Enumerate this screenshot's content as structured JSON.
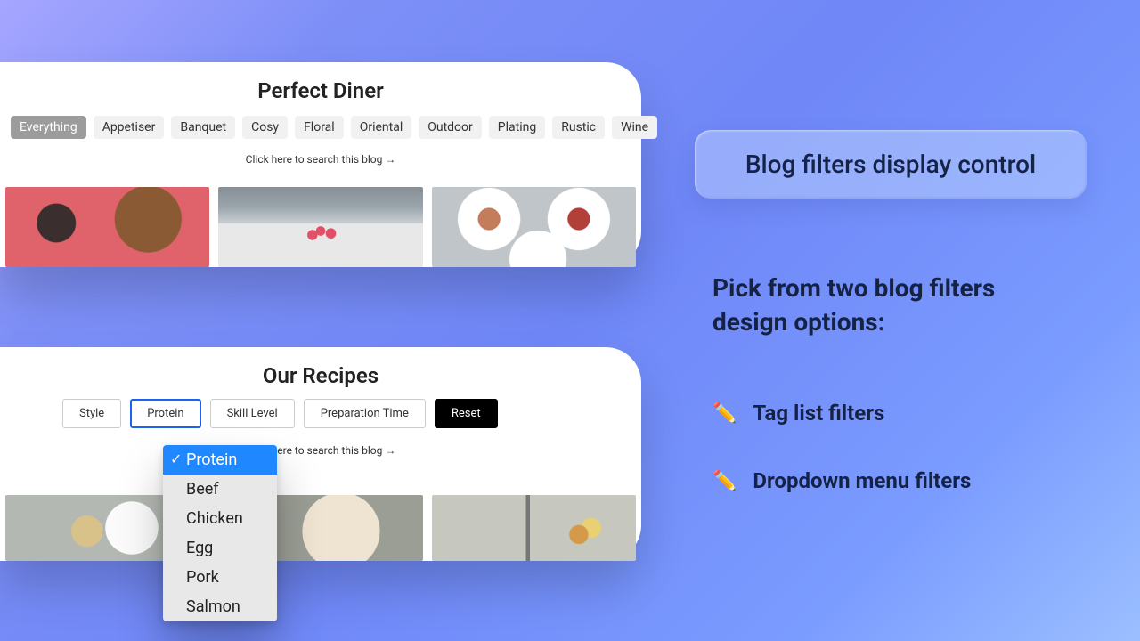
{
  "card1": {
    "title": "Perfect Diner",
    "tags": [
      "Everything",
      "Appetiser",
      "Banquet",
      "Cosy",
      "Floral",
      "Oriental",
      "Outdoor",
      "Plating",
      "Rustic",
      "Wine"
    ],
    "active_tag_index": 0,
    "search_hint": "Click here to search this blog",
    "arrow": "→"
  },
  "card2": {
    "title": "Our Recipes",
    "selectors": [
      "Style",
      "Protein",
      "Skill Level",
      "Preparation Time"
    ],
    "active_selector_index": 1,
    "reset_label": "Reset",
    "search_hint": "Click here to search this blog",
    "arrow": "→"
  },
  "dropdown": {
    "items": [
      "Protein",
      "Beef",
      "Chicken",
      "Egg",
      "Pork",
      "Salmon"
    ],
    "selected_index": 0
  },
  "right": {
    "badge": "Blog filters display control",
    "intro": "Pick from two blog filters design options:",
    "bullets": [
      "Tag list filters",
      "Dropdown menu filters"
    ],
    "pencil_emoji": "✏️"
  }
}
